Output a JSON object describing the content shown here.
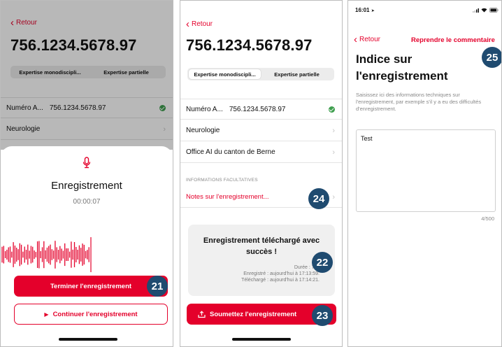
{
  "common": {
    "back_label": "Retour",
    "number": "756.1234.5678.97",
    "seg_left": "Expertise monodiscipli...",
    "seg_right": "Expertise partielle",
    "row_number_label": "Numéro A...",
    "row_number_value": "756.1234.5678.97",
    "row_neurology": "Neurologie",
    "row_office": "Office AI du canton de Berne"
  },
  "screen1": {
    "title": "Enregistrement",
    "timer": "00:00:07",
    "stop_button": "Terminer l'enregistrement",
    "continue_button": "Continuer l'enregistrement",
    "badge_stop": "21"
  },
  "screen2": {
    "section_header": "INFORMATIONS FACULTATIVES",
    "notes_link": "Notes sur l'enregistrement...",
    "badge_notes": "24",
    "success_title": "Enregistrement téléchargé avec succès !",
    "duration": "Durée : 7 s.",
    "recorded": "Enregistré : aujourd'hui à 17:13:59.",
    "uploaded": "Téléchargé : aujourd'hui à 17:14:21.",
    "badge_card": "22",
    "submit_button": "Soumettez l'enregistrement",
    "badge_submit": "23"
  },
  "screen3": {
    "status_time": "16:01",
    "resume_label": "Reprendre le commentaire",
    "title": "Indice sur l'enregistrement",
    "badge_title": "25",
    "description": "Saisissez ici des informations techniques sur l'enregistrement, par exemple s'il y a eu des difficultés d'enregistrement.",
    "textarea_value": "Test",
    "counter": "4/500"
  },
  "colors": {
    "accent": "#e4002b",
    "badge": "#1f4b70",
    "success": "#3f9f4f"
  },
  "icons": [
    "microphone-icon",
    "chevron-left-icon",
    "chevron-right-icon",
    "check-icon",
    "play-icon",
    "upload-icon",
    "location-arrow-icon",
    "signal-icon",
    "wifi-icon",
    "battery-icon"
  ]
}
